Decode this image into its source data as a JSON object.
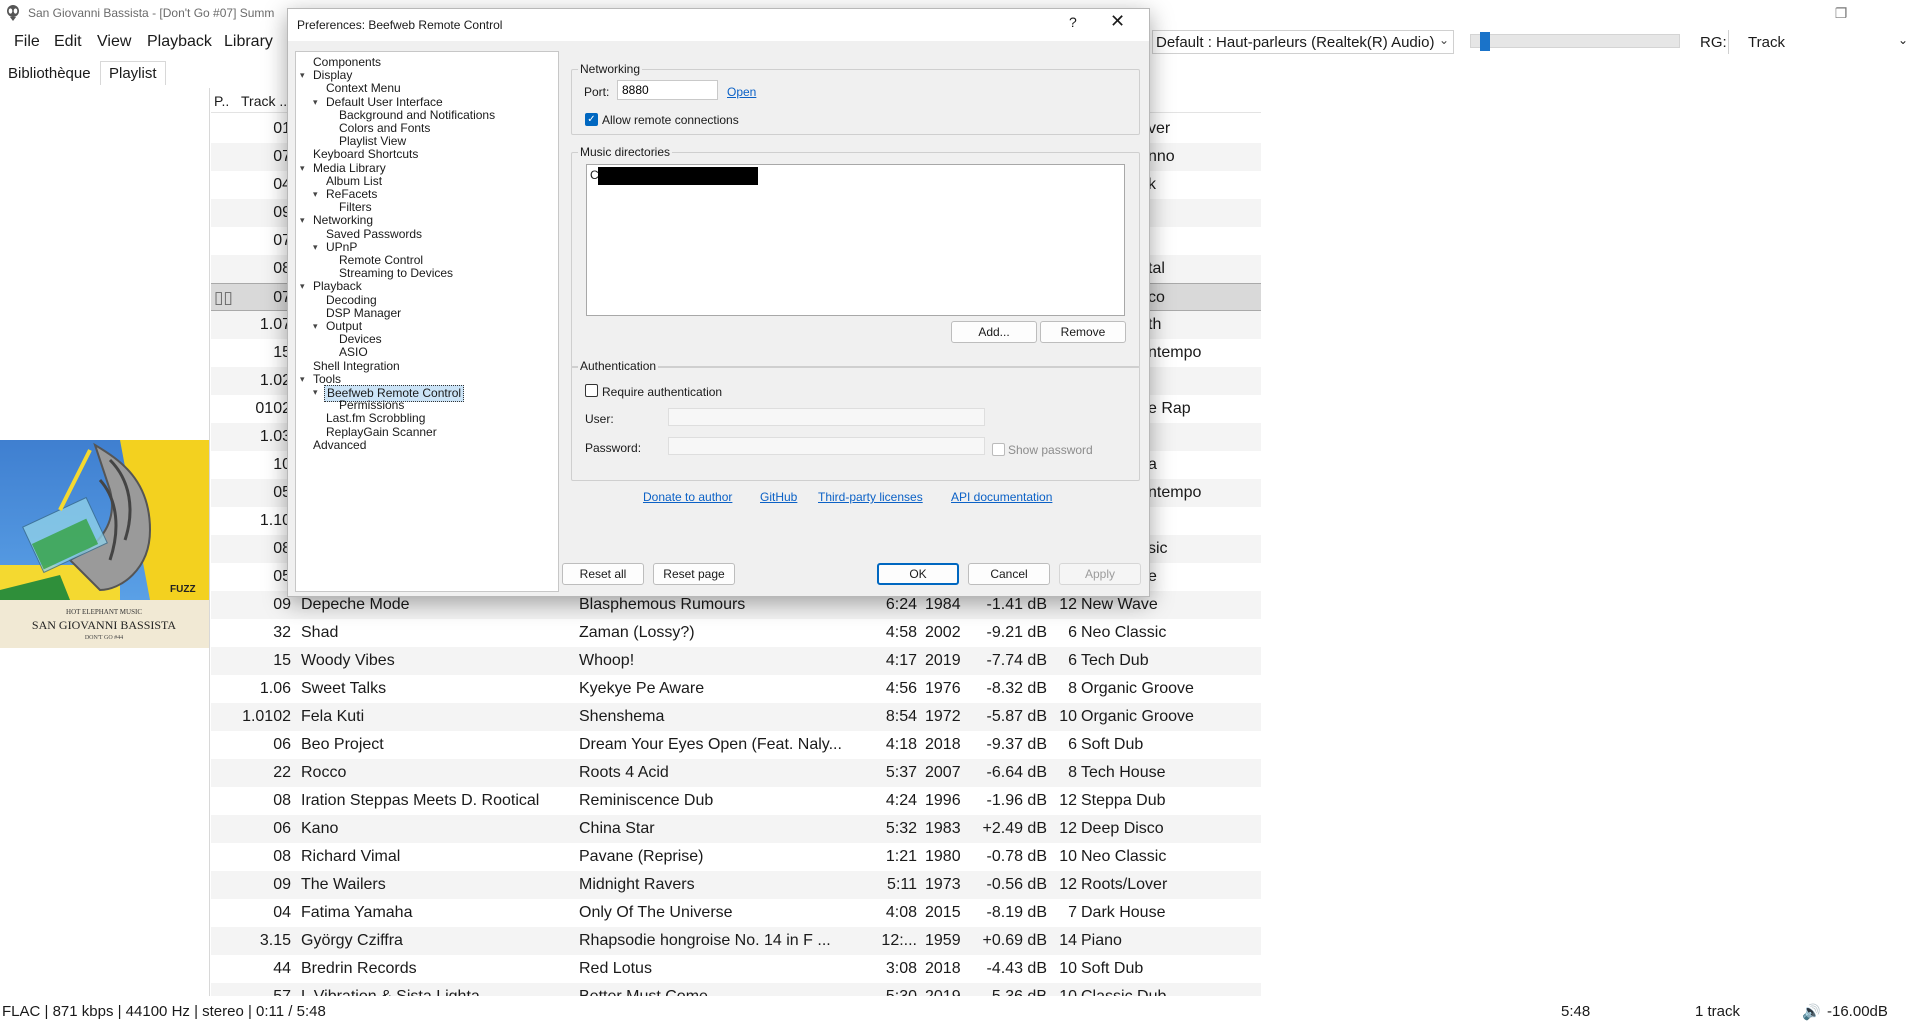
{
  "window": {
    "title": "San Giovanni Bassista - [Don't Go #07] Summ",
    "min_glyph": "—",
    "max_glyph": "❐",
    "close_glyph": "✕"
  },
  "menu": [
    "File",
    "Edit",
    "View",
    "Playback",
    "Library"
  ],
  "toolbar": {
    "output_device": "Default : Haut-parleurs (Realtek(R) Audio)",
    "volume_fraction": 0.03,
    "rg_label": "RG:",
    "rg_value": "Track"
  },
  "tabs": [
    "Bibliothèque",
    "Playlist"
  ],
  "album_art": {
    "label_top": "HOT ELEPHANT MUSIC",
    "artist": "SAN GIOVANNI BASSISTA",
    "subtitle": "DON'T GO #44",
    "badge": "FUZZ"
  },
  "playlist": {
    "headers": [
      "P..",
      "Track ..."
    ],
    "rows": [
      {
        "track": "01",
        "genre": "ver"
      },
      {
        "track": "07",
        "genre": "nno"
      },
      {
        "track": "04",
        "genre": "k"
      },
      {
        "track": "09",
        "genre": ""
      },
      {
        "track": "07",
        "genre": ""
      },
      {
        "track": "08",
        "genre": "tal"
      },
      {
        "track": "07",
        "genre": "co",
        "selected": true,
        "playing": true
      },
      {
        "track": "1.07",
        "genre": "th"
      },
      {
        "track": "15",
        "genre": "ntempo"
      },
      {
        "track": "1.02",
        "genre": ""
      },
      {
        "track": "0102",
        "genre": "e Rap"
      },
      {
        "track": "1.03",
        "genre": ""
      },
      {
        "track": "10",
        "genre": "a"
      },
      {
        "track": "05",
        "genre": "ntempo"
      },
      {
        "track": "1.10",
        "genre": ""
      },
      {
        "track": "08",
        "genre": "sic"
      },
      {
        "track": "05",
        "genre": "e"
      },
      {
        "track": "09",
        "artist": "Depeche Mode",
        "title": "Blasphemous Rumours",
        "length": "6:24",
        "year": "1984",
        "rg": "-1.41 dB",
        "rating": "12",
        "genre": "New Wave"
      },
      {
        "track": "32",
        "artist": "Shad",
        "title": "Zaman (Lossy?)",
        "length": "4:58",
        "year": "2002",
        "rg": "-9.21 dB",
        "rating": "6",
        "genre": "Neo Classic"
      },
      {
        "track": "15",
        "artist": "Woody Vibes",
        "title": "Whoop!",
        "length": "4:17",
        "year": "2019",
        "rg": "-7.74 dB",
        "rating": "6",
        "genre": "Tech Dub"
      },
      {
        "track": "1.06",
        "artist": "Sweet Talks",
        "title": "Kyekye Pe Aware",
        "length": "4:56",
        "year": "1976",
        "rg": "-8.32 dB",
        "rating": "8",
        "genre": "Organic Groove"
      },
      {
        "track": "1.0102",
        "artist": "Fela Kuti",
        "title": "Shenshema",
        "length": "8:54",
        "year": "1972",
        "rg": "-5.87 dB",
        "rating": "10",
        "genre": "Organic Groove"
      },
      {
        "track": "06",
        "artist": "Beo Project",
        "title": "Dream Your Eyes Open (Feat. Naly...",
        "length": "4:18",
        "year": "2018",
        "rg": "-9.37 dB",
        "rating": "6",
        "genre": "Soft Dub"
      },
      {
        "track": "22",
        "artist": "Rocco",
        "title": "Roots 4 Acid",
        "length": "5:37",
        "year": "2007",
        "rg": "-6.64 dB",
        "rating": "8",
        "genre": "Tech House"
      },
      {
        "track": "08",
        "artist": "Iration Steppas Meets D. Rootical",
        "title": "Reminiscence Dub",
        "length": "4:24",
        "year": "1996",
        "rg": "-1.96 dB",
        "rating": "12",
        "genre": "Steppa Dub"
      },
      {
        "track": "06",
        "artist": "Kano",
        "title": "China Star",
        "length": "5:32",
        "year": "1983",
        "rg": "+2.49 dB",
        "rating": "12",
        "genre": "Deep Disco"
      },
      {
        "track": "08",
        "artist": "Richard Vimal",
        "title": "Pavane (Reprise)",
        "length": "1:21",
        "year": "1980",
        "rg": "-0.78 dB",
        "rating": "10",
        "genre": "Neo Classic"
      },
      {
        "track": "09",
        "artist": "The Wailers",
        "title": "Midnight Ravers",
        "length": "5:11",
        "year": "1973",
        "rg": "-0.56 dB",
        "rating": "12",
        "genre": "Roots/Lover"
      },
      {
        "track": "04",
        "artist": "Fatima Yamaha",
        "title": "Only Of The Universe",
        "length": "4:08",
        "year": "2015",
        "rg": "-8.19 dB",
        "rating": "7",
        "genre": "Dark House"
      },
      {
        "track": "3.15",
        "artist": "György Cziffra",
        "title": "Rhapsodie hongroise No. 14 in F ...",
        "length": "12:...",
        "year": "1959",
        "rg": "+0.69 dB",
        "rating": "14",
        "genre": "Piano"
      },
      {
        "track": "44",
        "artist": "Bredrin Records",
        "title": "Red Lotus",
        "length": "3:08",
        "year": "2018",
        "rg": "-4.43 dB",
        "rating": "10",
        "genre": "Soft Dub"
      },
      {
        "track": "57",
        "artist": "L Vibration & Sista Lighta",
        "title": "Better Must Come",
        "length": "5:30",
        "year": "2019",
        "rg": "-5.36 dB",
        "rating": "10",
        "genre": "Classic Dub"
      }
    ]
  },
  "status": {
    "info": "FLAC | 871 kbps | 44100 Hz | stereo | 0:11 / 5:48",
    "total": "5:48",
    "count": "1 track",
    "volume": "-16.00dB"
  },
  "dialog": {
    "title": "Preferences: Beefweb Remote Control",
    "help": "?",
    "close": "✕",
    "tree": [
      {
        "label": "Components",
        "level": 0
      },
      {
        "label": "Display",
        "level": 0,
        "expanded": true
      },
      {
        "label": "Context Menu",
        "level": 1
      },
      {
        "label": "Default User Interface",
        "level": 1,
        "expanded": true
      },
      {
        "label": "Background and Notifications",
        "level": 2
      },
      {
        "label": "Colors and Fonts",
        "level": 2
      },
      {
        "label": "Playlist View",
        "level": 2
      },
      {
        "label": "Keyboard Shortcuts",
        "level": 0
      },
      {
        "label": "Media Library",
        "level": 0,
        "expanded": true
      },
      {
        "label": "Album List",
        "level": 1
      },
      {
        "label": "ReFacets",
        "level": 1,
        "expanded": true
      },
      {
        "label": "Filters",
        "level": 2
      },
      {
        "label": "Networking",
        "level": 0,
        "expanded": true
      },
      {
        "label": "Saved Passwords",
        "level": 1
      },
      {
        "label": "UPnP",
        "level": 1,
        "expanded": true
      },
      {
        "label": "Remote Control",
        "level": 2
      },
      {
        "label": "Streaming to Devices",
        "level": 2
      },
      {
        "label": "Playback",
        "level": 0,
        "expanded": true
      },
      {
        "label": "Decoding",
        "level": 1
      },
      {
        "label": "DSP Manager",
        "level": 1
      },
      {
        "label": "Output",
        "level": 1,
        "expanded": true
      },
      {
        "label": "Devices",
        "level": 2
      },
      {
        "label": "ASIO",
        "level": 2
      },
      {
        "label": "Shell Integration",
        "level": 0
      },
      {
        "label": "Tools",
        "level": 0,
        "expanded": true
      },
      {
        "label": "Beefweb Remote Control",
        "level": 1,
        "expanded": true,
        "selected": true
      },
      {
        "label": "Permissions",
        "level": 2
      },
      {
        "label": "Last.fm Scrobbling",
        "level": 1
      },
      {
        "label": "ReplayGain Scanner",
        "level": 1
      },
      {
        "label": "Advanced",
        "level": 0
      }
    ],
    "networking": {
      "group_title": "Networking",
      "port_label": "Port:",
      "port_value": "8880",
      "open_link": "Open",
      "allow_remote_label": "Allow remote connections",
      "allow_remote_checked": true
    },
    "music": {
      "group_title": "Music directories",
      "first_item_prefix": "C",
      "add_button": "Add...",
      "remove_button": "Remove"
    },
    "auth": {
      "group_title": "Authentication",
      "require_label": "Require authentication",
      "user_label": "User:",
      "password_label": "Password:",
      "show_password_label": "Show password"
    },
    "links": [
      "Donate to author",
      "GitHub",
      "Third-party licenses",
      "API documentation"
    ],
    "buttons": {
      "reset_all": "Reset all",
      "reset_page": "Reset page",
      "ok": "OK",
      "cancel": "Cancel",
      "apply": "Apply"
    }
  },
  "colors": {
    "accent": "#0067c0",
    "selected_row": "#d9d9d9",
    "dialog_bg": "#f0f0f0"
  }
}
